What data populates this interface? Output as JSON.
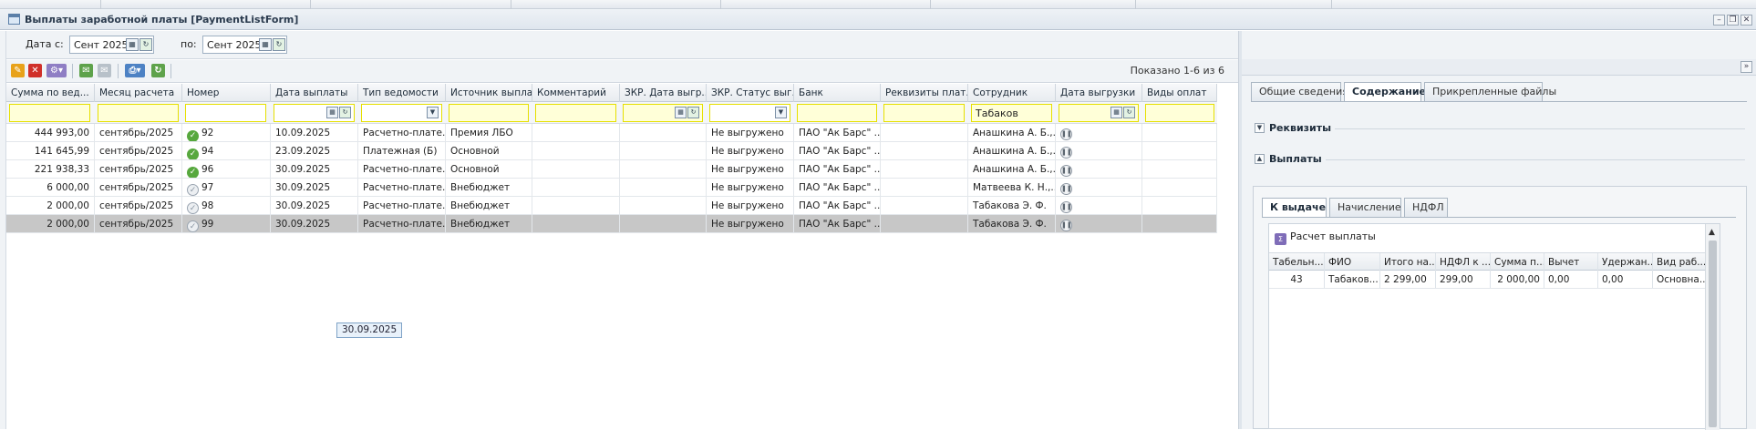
{
  "window": {
    "title": "Выплаты заработной платы [PaymentListForm]"
  },
  "filter_bar": {
    "date_from_label": "Дата с:",
    "date_from_value": "Сент 2025",
    "date_to_label": "по:",
    "date_to_value": "Сент 2025"
  },
  "toolbar": {
    "shown_text": "Показано 1-6 из 6"
  },
  "grid": {
    "columns": [
      "Сумма по вед...",
      "Месяц расчета",
      "Номер",
      "Дата выплаты",
      "Тип ведомости",
      "Источник выплат",
      "Комментарий",
      "ЗКР. Дата выгр...",
      "ЗКР. Статус выг...",
      "Банк",
      "Реквизиты плат...",
      "Сотрудник",
      "Дата выгрузки",
      "Виды оплат"
    ],
    "employee_filter": "Табаков",
    "rows": [
      {
        "sum": "444 993,00",
        "month": "сентябрь/2025",
        "number": "92",
        "date": "10.09.2025",
        "type": "Расчетно-плате...",
        "source": "Премия ЛБО",
        "comment": "",
        "zkr_date": "",
        "zkr_status": "Не выгружено",
        "bank": "ПАО \"Ак Барс\" ...",
        "req": "",
        "employee": "Анашкина А. Б.,...",
        "uploaded": "",
        "pay_types": "",
        "status": "ok"
      },
      {
        "sum": "141 645,99",
        "month": "сентябрь/2025",
        "number": "94",
        "date": "23.09.2025",
        "type": "Платежная (Б)",
        "source": "Основной",
        "comment": "",
        "zkr_date": "",
        "zkr_status": "Не выгружено",
        "bank": "ПАО \"Ак Барс\" ...",
        "req": "",
        "employee": "Анашкина А. Б.,...",
        "uploaded": "",
        "pay_types": "",
        "status": "ok"
      },
      {
        "sum": "221 938,33",
        "month": "сентябрь/2025",
        "number": "96",
        "date": "30.09.2025",
        "type": "Расчетно-плате...",
        "source": "Основной",
        "comment": "",
        "zkr_date": "",
        "zkr_status": "Не выгружено",
        "bank": "ПАО \"Ак Барс\" ...",
        "req": "",
        "employee": "Анашкина А. Б.,...",
        "uploaded": "",
        "pay_types": "",
        "status": "ok"
      },
      {
        "sum": "6 000,00",
        "month": "сентябрь/2025",
        "number": "97",
        "date": "30.09.2025",
        "type": "Расчетно-плате...",
        "source": "Внебюджет",
        "comment": "",
        "zkr_date": "",
        "zkr_status": "Не выгружено",
        "bank": "ПАО \"Ак Барс\" ...",
        "req": "",
        "employee": "Матвеева К. Н.,...",
        "uploaded": "",
        "pay_types": "",
        "status": "pending"
      },
      {
        "sum": "2 000,00",
        "month": "сентябрь/2025",
        "number": "98",
        "date": "30.09.2025",
        "type": "Расчетно-плате...",
        "source": "Внебюджет",
        "comment": "",
        "zkr_date": "",
        "zkr_status": "Не выгружено",
        "bank": "ПАО \"Ак Барс\" ...",
        "req": "",
        "employee": "Табакова Э. Ф.",
        "uploaded": "",
        "pay_types": "",
        "status": "pending"
      },
      {
        "sum": "2 000,00",
        "month": "сентябрь/2025",
        "number": "99",
        "date": "30.09.2025",
        "type": "Расчетно-плате...",
        "source": "Внебюджет",
        "comment": "",
        "zkr_date": "",
        "zkr_status": "Не выгружено",
        "bank": "ПАО \"Ак Барс\" ...",
        "req": "",
        "employee": "Табакова Э. Ф.",
        "uploaded": "",
        "pay_types": "",
        "status": "pending"
      }
    ],
    "tooltip": "30.09.2025"
  },
  "right_panel": {
    "tabs": [
      "Общие сведения",
      "Содержание",
      "Прикрепленные файлы"
    ],
    "active_tab": "Содержание",
    "section_requisites": "Реквизиты",
    "section_payments": "Выплаты",
    "inner_tabs": [
      "К выдаче",
      "Начисление",
      "НДФЛ"
    ],
    "calc_button": "Расчет выплаты",
    "inner_columns": [
      "Табельн...",
      "ФИО",
      "Итого на...",
      "НДФЛ к ...",
      "Сумма п...",
      "Вычет",
      "Удержан...",
      "Вид раб..."
    ],
    "inner_row": [
      "43",
      "Табаков...",
      "2 299,00",
      "299,00",
      "2 000,00",
      "0,00",
      "0,00",
      "Основна..."
    ]
  }
}
